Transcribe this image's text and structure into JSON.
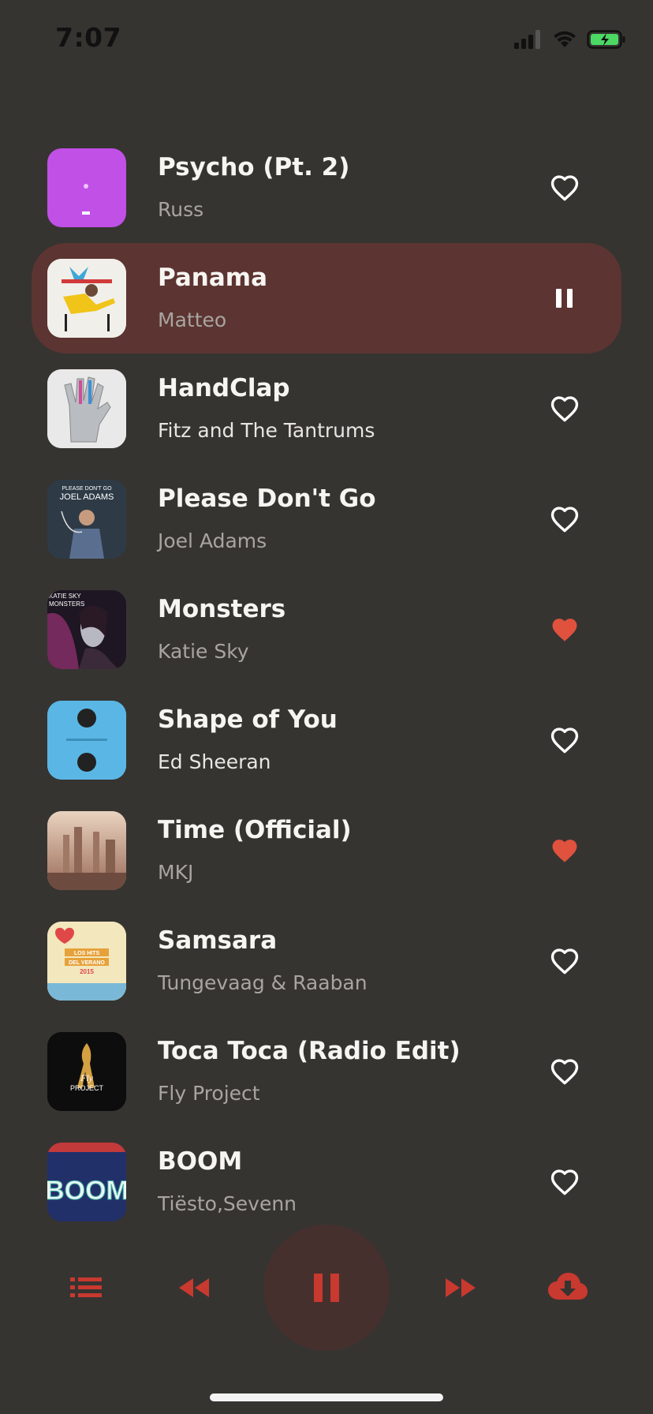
{
  "status_bar": {
    "time": "7:07",
    "signal_icon": "cellular-signal-icon",
    "wifi_icon": "wifi-icon",
    "battery_icon": "battery-charging-icon"
  },
  "colors": {
    "background": "#363431",
    "accent": "#c8392f",
    "active_row": "#5c3431",
    "liked": "#e0513e"
  },
  "tracks": [
    {
      "title": "Psycho (Pt. 2)",
      "artist": "Russ",
      "liked": false,
      "active": false
    },
    {
      "title": "Panama",
      "artist": "Matteo",
      "liked": false,
      "active": true
    },
    {
      "title": "HandClap",
      "artist": "Fitz and The Tantrums",
      "liked": false,
      "active": false
    },
    {
      "title": "Please Don't Go",
      "artist": "Joel Adams",
      "liked": false,
      "active": false,
      "cover_text": [
        "PLEASE DON'T GO",
        "JOEL ADAMS"
      ]
    },
    {
      "title": "Monsters",
      "artist": "Katie Sky",
      "liked": true,
      "active": false,
      "cover_text": [
        "KATIE SKY",
        "MONSTERS"
      ]
    },
    {
      "title": "Shape of You",
      "artist": "Ed Sheeran",
      "liked": false,
      "active": false
    },
    {
      "title": "Time (Official)",
      "artist": "MKJ",
      "liked": true,
      "active": false
    },
    {
      "title": "Samsara",
      "artist": "Tungevaag & Raaban",
      "liked": false,
      "active": false,
      "cover_text": [
        "LOS HITS",
        "DEL VERANO",
        "2015"
      ]
    },
    {
      "title": "Toca Toca (Radio Edit)",
      "artist": "Fly Project",
      "liked": false,
      "active": false,
      "cover_text": [
        "Fly",
        "PROJECT"
      ]
    },
    {
      "title": "BOOM",
      "artist": "Tiësto,Sevenn",
      "liked": false,
      "active": false,
      "cover_text": [
        "BOOM"
      ]
    }
  ],
  "player": {
    "controls": [
      "playlist-icon",
      "rewind-icon",
      "pause-icon",
      "fast-forward-icon",
      "cloud-download-icon"
    ]
  }
}
